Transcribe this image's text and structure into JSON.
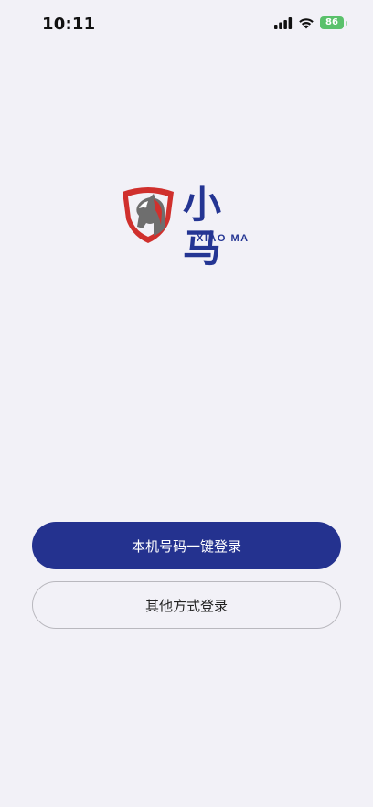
{
  "status_bar": {
    "time": "10:11",
    "battery": "86",
    "icons": [
      "cellular-signal-icon",
      "wifi-icon",
      "battery-charging-icon"
    ],
    "battery_color": "#5ac16b"
  },
  "logo": {
    "chinese": "小马",
    "latin": "XIAO MA",
    "brand_color": "#243593",
    "emblem_color": "#d0302d"
  },
  "actions": {
    "primary_label": "本机号码一键登录",
    "secondary_label": "其他方式登录",
    "primary_color": "#24328f"
  }
}
